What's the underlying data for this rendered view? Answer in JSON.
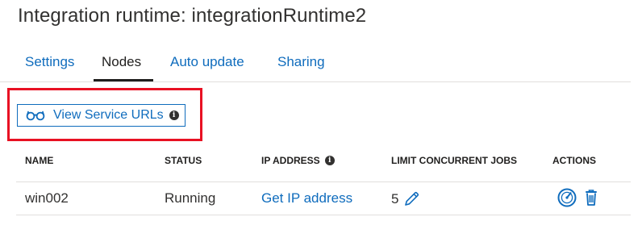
{
  "title": "Integration runtime: integrationRuntime2",
  "tabs": [
    {
      "label": "Settings",
      "active": false
    },
    {
      "label": "Nodes",
      "active": true
    },
    {
      "label": "Auto update",
      "active": false
    },
    {
      "label": "Sharing",
      "active": false
    }
  ],
  "toolbar": {
    "view_service_urls_label": "View Service URLs",
    "icon": "glasses-icon"
  },
  "table": {
    "columns": [
      "NAME",
      "STATUS",
      "IP ADDRESS",
      "LIMIT CONCURRENT JOBS",
      "ACTIONS"
    ],
    "rows": [
      {
        "name": "win002",
        "status": "Running",
        "ip_address": "Get IP address",
        "limit_concurrent_jobs": "5",
        "actions": [
          "gauge-icon",
          "trash-icon"
        ]
      }
    ]
  },
  "colors": {
    "accent": "#0f6cbd",
    "highlight": "#e81123",
    "text": "#323130"
  }
}
